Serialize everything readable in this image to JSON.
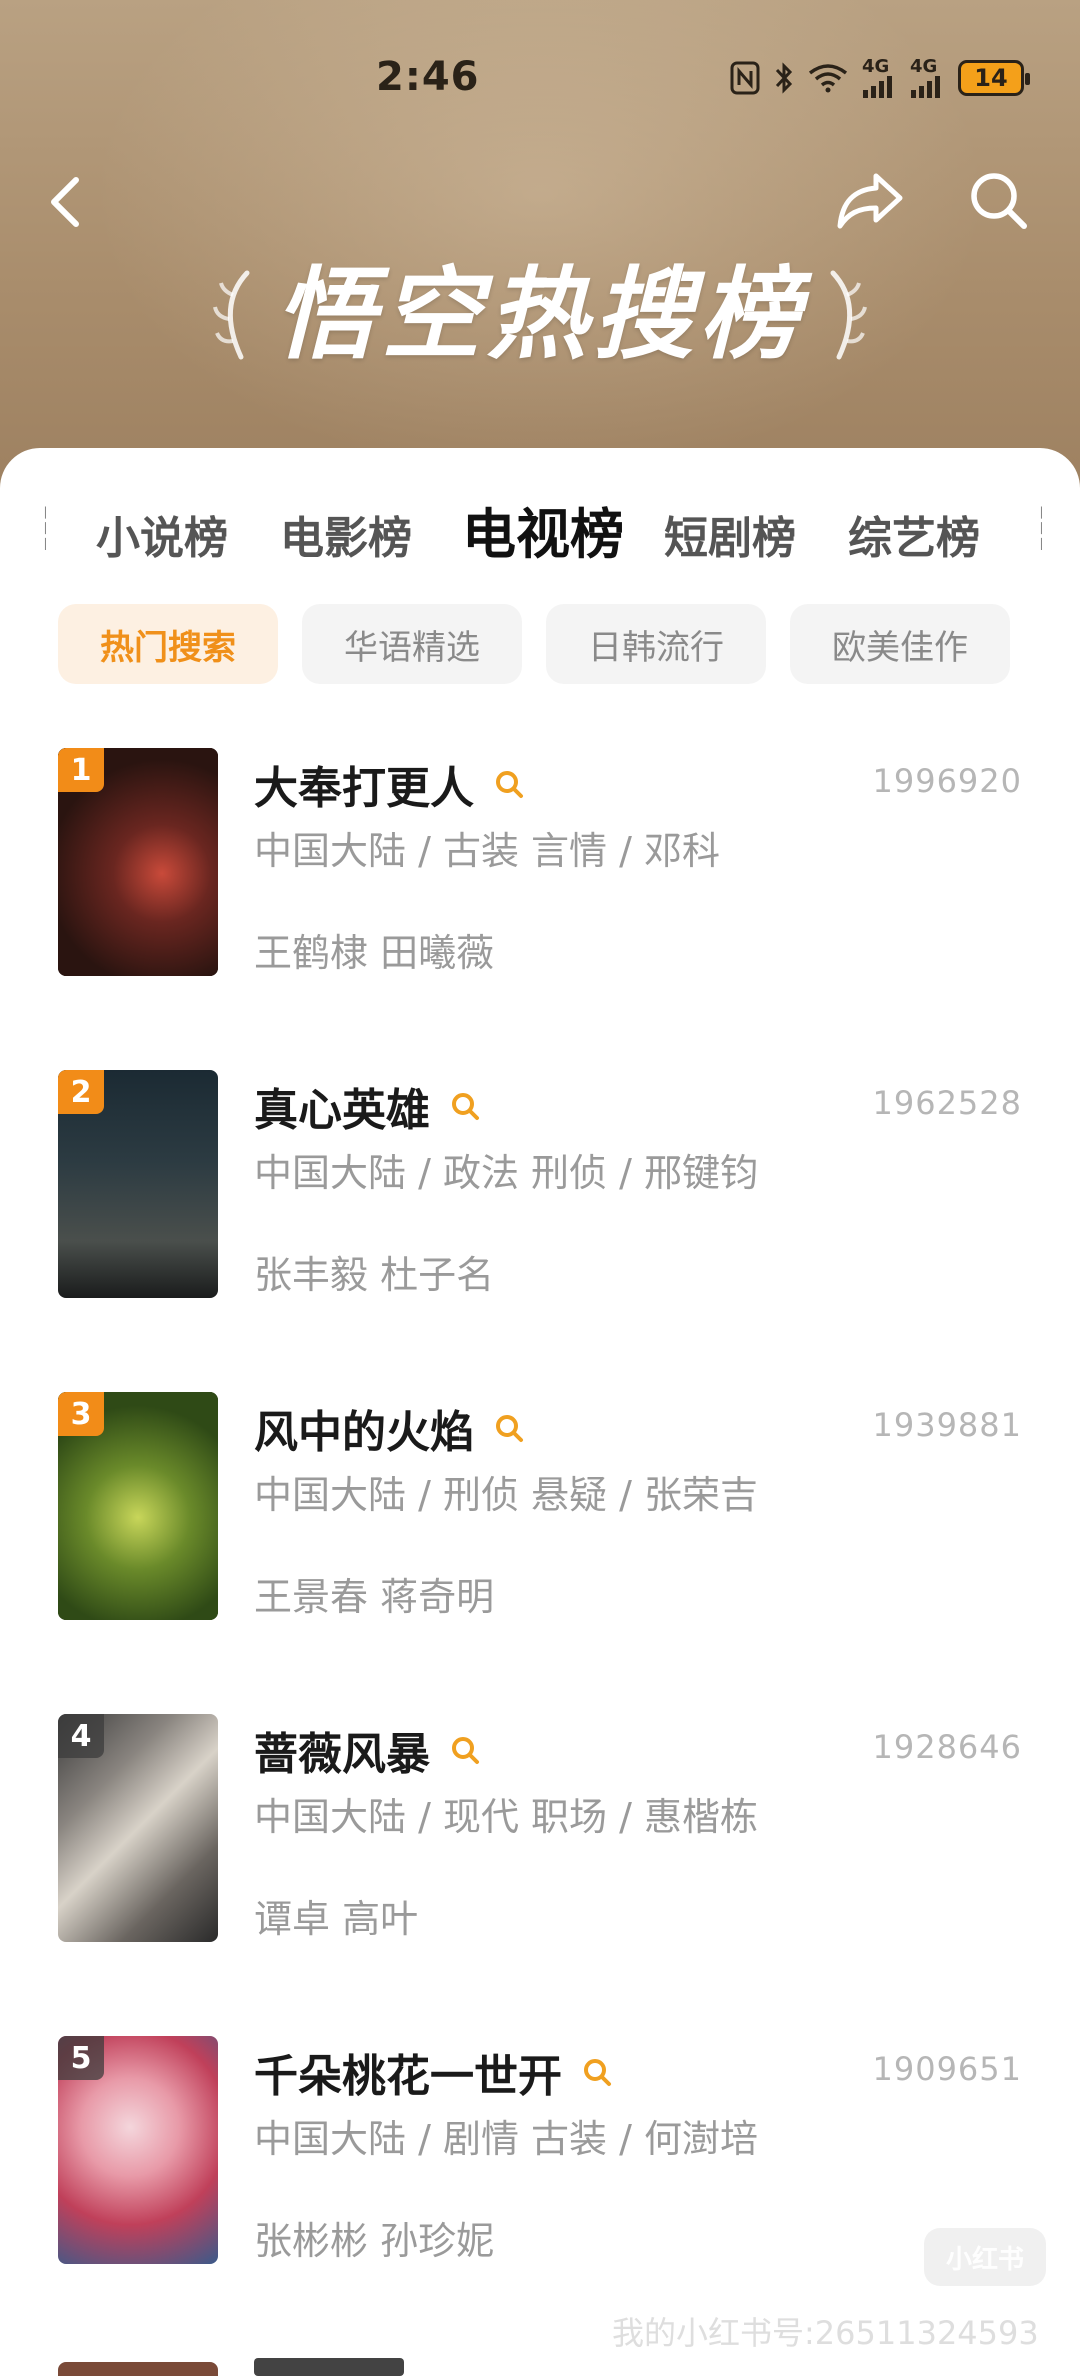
{
  "status": {
    "time": "2:46",
    "battery": "14",
    "net1": "4G",
    "net2": "4G"
  },
  "header": {
    "title": "悟空热搜榜"
  },
  "tabs": [
    "小说榜",
    "电影榜",
    "电视榜",
    "短剧榜",
    "综艺榜"
  ],
  "active_tab": "电视榜",
  "chips": [
    "热门搜索",
    "华语精选",
    "日韩流行",
    "欧美佳作"
  ],
  "active_chip": "热门搜索",
  "items": [
    {
      "rank": "1",
      "title": "大奉打更人",
      "score": "1996920",
      "meta": "中国大陆 / 古装 言情 / 邓科",
      "cast": "王鹤棣 田曦薇"
    },
    {
      "rank": "2",
      "title": "真心英雄",
      "score": "1962528",
      "meta": "中国大陆 / 政法 刑侦 / 邢键钧",
      "cast": "张丰毅 杜子名"
    },
    {
      "rank": "3",
      "title": "风中的火焰",
      "score": "1939881",
      "meta": "中国大陆 / 刑侦 悬疑 / 张荣吉",
      "cast": "王景春 蒋奇明"
    },
    {
      "rank": "4",
      "title": "蔷薇风暴",
      "score": "1928646",
      "meta": "中国大陆 / 现代 职场 / 惠楷栋",
      "cast": "谭卓 高叶"
    },
    {
      "rank": "5",
      "title": "千朵桃花一世开",
      "score": "1909651",
      "meta": "中国大陆 / 剧情 古装 / 何澍培",
      "cast": "张彬彬 孙珍妮"
    }
  ],
  "watermark": {
    "logo": "小红书",
    "text": "我的小红书号:26511324593"
  },
  "colors": {
    "accent": "#f28c18",
    "header_bg": "#a98d6c"
  }
}
